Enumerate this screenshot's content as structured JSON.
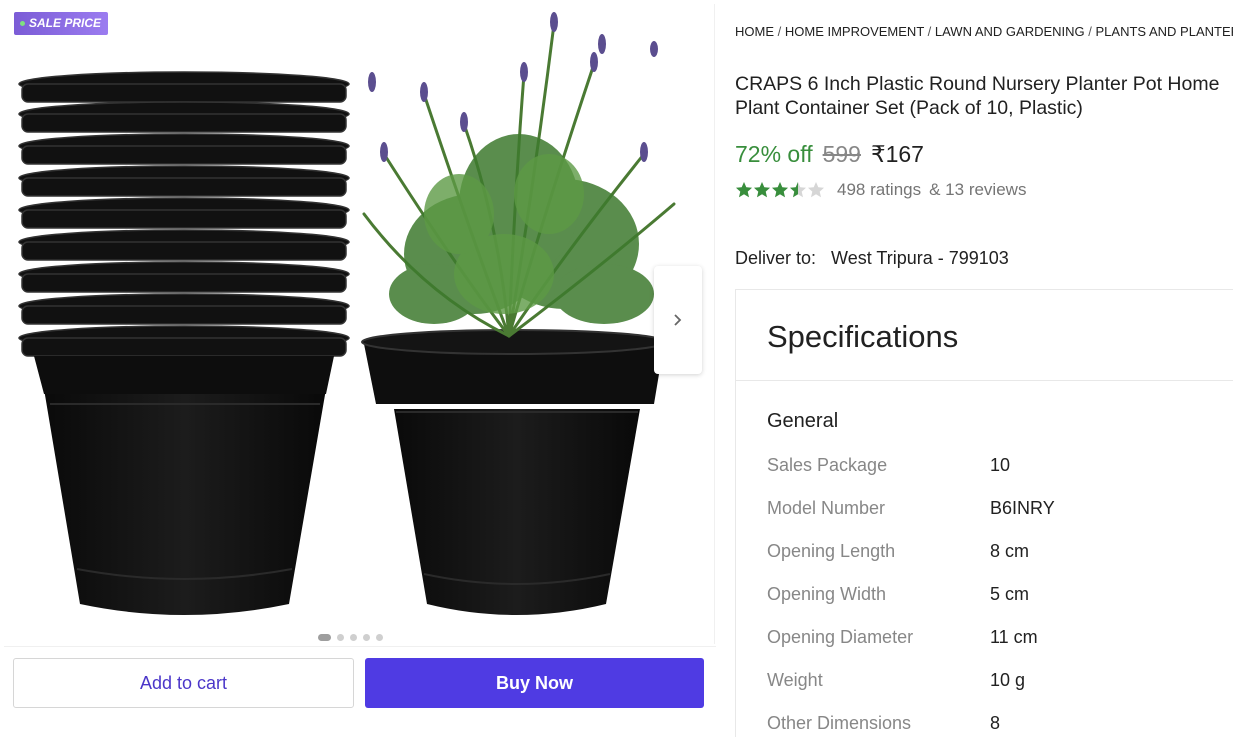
{
  "badge": {
    "label": "SALE PRICE"
  },
  "gallery": {
    "next_icon": "chevron-right-icon",
    "dot_count": 5,
    "active_dot": 0
  },
  "actions": {
    "add_to_cart": "Add to cart",
    "buy_now": "Buy Now"
  },
  "breadcrumb": [
    "HOME",
    "HOME IMPROVEMENT",
    "LAWN AND GARDENING",
    "PLANTS AND PLANTERS"
  ],
  "product": {
    "title": "CRAPS 6 Inch Plastic Round Nursery Planter Pot Home Plant Container Set (Pack of 10, Plastic)",
    "discount": "72% off",
    "mrp": "599",
    "price": "₹167",
    "rating_value": 3.5,
    "ratings_text": "498 ratings",
    "reviews_text": "& 13 reviews"
  },
  "delivery": {
    "label": "Deliver to:",
    "location": "West Tripura - 799103"
  },
  "specifications": {
    "heading": "Specifications",
    "group": "General",
    "rows": [
      {
        "key": "Sales Package",
        "value": "10"
      },
      {
        "key": "Model Number",
        "value": "B6INRY"
      },
      {
        "key": "Opening Length",
        "value": "8 cm"
      },
      {
        "key": "Opening Width",
        "value": "5 cm"
      },
      {
        "key": "Opening Diameter",
        "value": "11 cm"
      },
      {
        "key": "Weight",
        "value": "10 g"
      },
      {
        "key": "Other Dimensions",
        "value": "8"
      }
    ]
  },
  "colors": {
    "accent": "#4f3be3",
    "discount_green": "#388e3c",
    "star_green": "#388e3c",
    "badge_purple": "#8b6be6"
  }
}
